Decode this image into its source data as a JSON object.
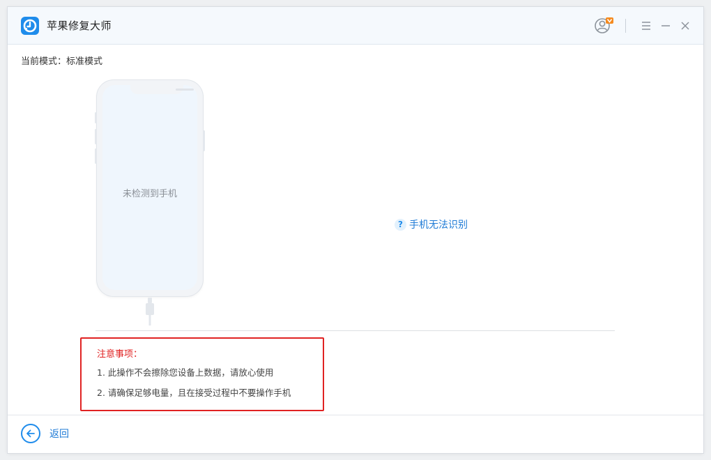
{
  "window": {
    "title": "苹果修复大师",
    "icons": {
      "logo": "app-logo-icon",
      "user": "user-vip-icon",
      "menu": "menu-icon",
      "minimize": "minimize-icon",
      "close": "close-icon"
    }
  },
  "mode": {
    "label": "当前模式：标准模式"
  },
  "phone": {
    "status": "未检测到手机"
  },
  "help": {
    "label": "手机无法识别",
    "icon": "question-icon"
  },
  "notes": {
    "title": "注意事项：",
    "items": [
      "1. 此操作不会擦除您设备上数据，请放心使用",
      "2. 请确保足够电量，且在接受过程中不要操作手机"
    ]
  },
  "footer": {
    "back_label": "返回",
    "back_icon": "arrow-left-icon"
  },
  "colors": {
    "accent": "#1f8ceb",
    "warning": "#e02222",
    "vip_badge": "#f58a1f"
  }
}
